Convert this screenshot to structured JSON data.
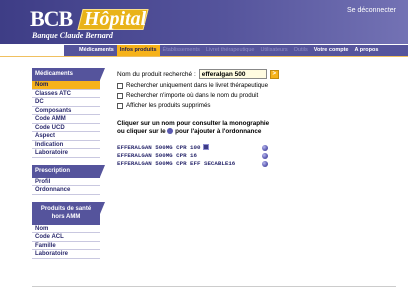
{
  "header": {
    "logo_main": "BCB",
    "logo_badge": "Hôpital",
    "logo_sub": "Banque Claude Bernard",
    "logout": "Se déconnecter"
  },
  "nav": {
    "tabs": [
      {
        "label": "Médicaments",
        "state": "normal"
      },
      {
        "label": "Infos produits",
        "state": "active"
      },
      {
        "label": "Établissements",
        "state": "disabled"
      },
      {
        "label": "Livret thérapeutique",
        "state": "disabled"
      },
      {
        "label": "Utilisateurs",
        "state": "disabled"
      },
      {
        "label": "Outils",
        "state": "disabled"
      },
      {
        "label": "Votre compte",
        "state": "normal"
      },
      {
        "label": "A propos",
        "state": "normal"
      }
    ]
  },
  "sidebar": {
    "medicaments": {
      "title": "Médicaments",
      "items": [
        "Nom",
        "Classes ATC",
        "DC",
        "Composants",
        "Code AMM",
        "Code UCD",
        "Aspect",
        "Indication",
        "Laboratoire"
      ]
    },
    "prescription": {
      "title": "Prescription",
      "items": [
        "Profil",
        "Ordonnance"
      ]
    },
    "sante": {
      "title_line1": "Produits de santé",
      "title_line2": "hors AMM",
      "items": [
        "Nom",
        "Code ACL",
        "Famille",
        "Laboratoire"
      ]
    }
  },
  "main": {
    "search_label": "Nom du produit recherché :",
    "search_value": "efferalgan 500",
    "go_label": ">",
    "options": [
      "Rechercher uniquement dans le livret thérapeutique",
      "Rechercher n'importe où dans le nom du produit",
      "Afficher les produits supprimés"
    ],
    "instruction_line1": "Cliquer sur un nom pour consulter la monographie",
    "instruction_line2_a": "ou cliquer sur le",
    "instruction_line2_b": "pour l'ajouter à l'ordonnance",
    "results": [
      {
        "name": "EFFERALGAN 500MG CPR 100",
        "livret": true
      },
      {
        "name": "EFFERALGAN 500MG CPR 16",
        "livret": false
      },
      {
        "name": "EFFERALGAN 500MG CPR EFF SECABLE16",
        "livret": false
      }
    ]
  },
  "colors": {
    "brand_purple": "#55549c",
    "accent_orange": "#f6b21a"
  }
}
